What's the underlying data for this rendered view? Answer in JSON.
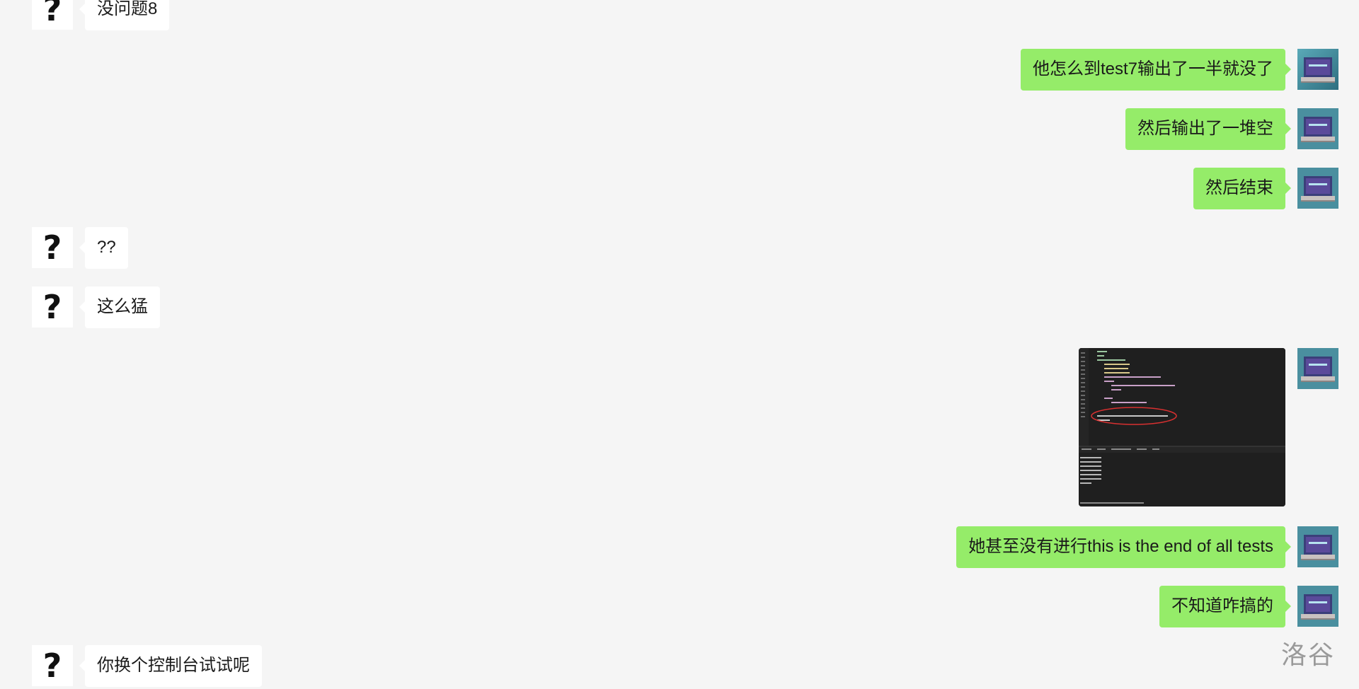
{
  "messages": [
    {
      "side": "left",
      "text": "没问题8"
    },
    {
      "side": "right",
      "text": "他怎么到test7输出了一半就没了"
    },
    {
      "side": "right",
      "text": "然后输出了一堆空"
    },
    {
      "side": "right",
      "text": "然后结束"
    },
    {
      "side": "left",
      "text": "??"
    },
    {
      "side": "left",
      "text": "这么猛"
    },
    {
      "side": "right",
      "type": "image",
      "alt": "code-screenshot"
    },
    {
      "side": "right",
      "text": "她甚至没有进行this is the end of all tests"
    },
    {
      "side": "right",
      "text": "不知道咋搞的"
    },
    {
      "side": "left",
      "text": "你换个控制台试试呢"
    }
  ],
  "avatars": {
    "left": {
      "glyph": "?",
      "icon": "question-mark-avatar"
    },
    "right": {
      "icon": "laptop-avatar"
    }
  },
  "watermark": "洛谷",
  "colors": {
    "background": "#f5f5f5",
    "left_bubble": "#ffffff",
    "right_bubble": "#95ec69"
  }
}
